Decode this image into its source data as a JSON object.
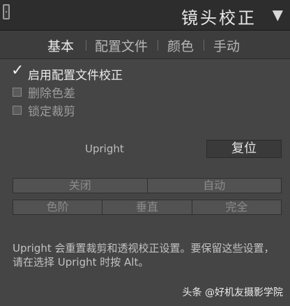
{
  "header": {
    "title": "镜头校正",
    "collapse_icon": "▼"
  },
  "tabs": [
    "基本",
    "配置文件",
    "颜色",
    "手动"
  ],
  "options": [
    {
      "label": "启用配置文件校正",
      "checked": true
    },
    {
      "label": "删除色差",
      "checked": false
    },
    {
      "label": "锁定裁剪",
      "checked": false
    }
  ],
  "upright": {
    "label": "Upright",
    "reset_label": "复位"
  },
  "row1": [
    "关闭",
    "自动"
  ],
  "row2": [
    "色阶",
    "垂直",
    "完全"
  ],
  "note": "Upright 会重置裁剪和透视校正设置。要保留这些设置，请在选择 Upright 时按 Alt。",
  "watermark": "头条 @好机友摄影学院",
  "colors": {
    "panel_bg": "#454545",
    "header_bg": "#2d2d2d",
    "text": "#d4d4d4"
  }
}
